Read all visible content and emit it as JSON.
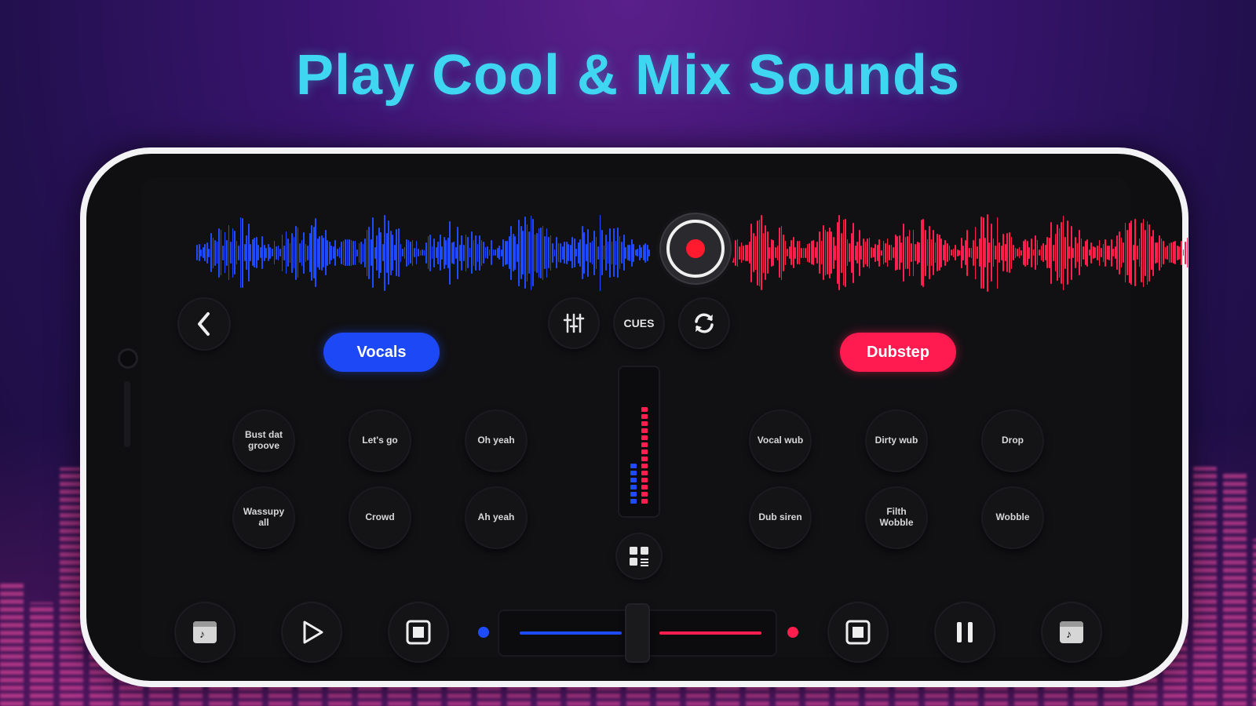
{
  "headline": "Play Cool & Mix Sounds",
  "colors": {
    "headline": "#3fd6f2",
    "deck_a": "#1f4bff",
    "deck_b": "#ff1e4d"
  },
  "top_controls": {
    "back_icon": "chevron-left-icon",
    "record_icon": "record-icon",
    "mixer_icon": "equalizer-sliders-icon",
    "cues_label": "CUES",
    "sync_icon": "sync-icon"
  },
  "deck_a": {
    "category": "Vocals",
    "pads": [
      "Bust dat groove",
      "Let's go",
      "Oh yeah",
      "Wassupy all",
      "Crowd",
      "Ah yeah"
    ],
    "transport": {
      "load_icon": "music-file-icon",
      "play_icon": "play-icon",
      "stop_icon": "stop-icon"
    }
  },
  "deck_b": {
    "category": "Dubstep",
    "pads": [
      "Vocal wub",
      "Dirty wub",
      "Drop",
      "Dub siren",
      "Filth Wobble",
      "Wobble"
    ],
    "transport": {
      "stop_icon": "stop-icon",
      "pause_icon": "pause-icon",
      "load_icon": "music-file-icon"
    }
  },
  "center": {
    "level_meter": {
      "deck_a_level": 0.35,
      "deck_b_level": 0.8
    },
    "grid_icon": "grid-icon",
    "crossfader_position": 0.5
  }
}
